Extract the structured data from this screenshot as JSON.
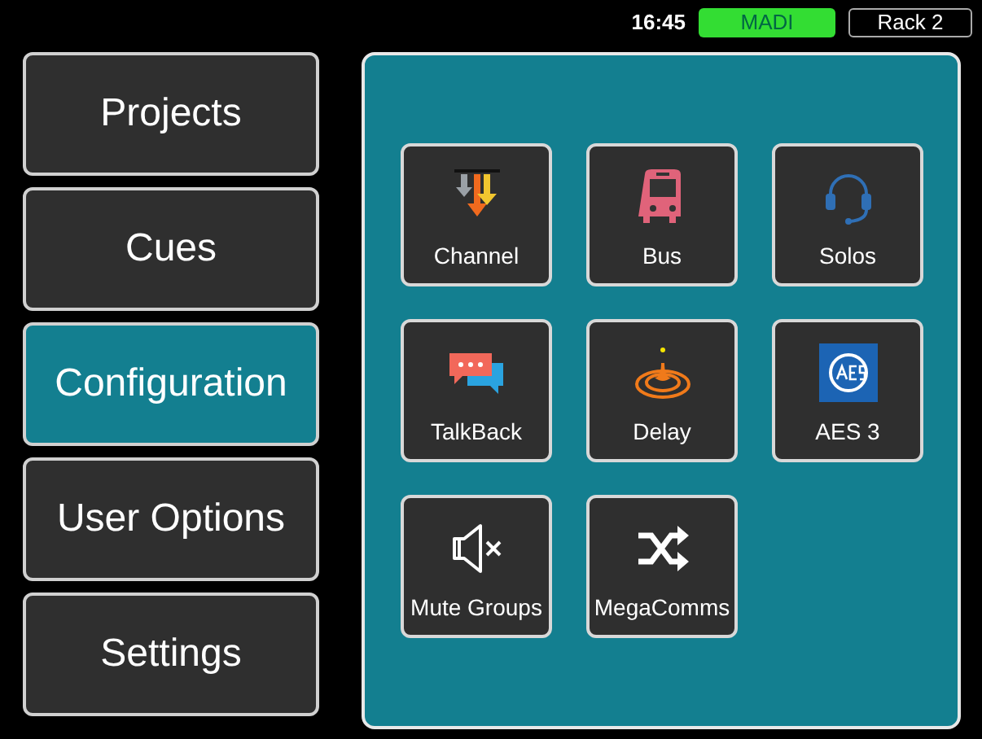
{
  "status_bar": {
    "time": "16:45",
    "interface": "MADI",
    "rack": "Rack 2"
  },
  "menu": [
    {
      "label": "Projects",
      "selected": false
    },
    {
      "label": "Cues",
      "selected": false
    },
    {
      "label": "Configuration",
      "selected": true
    },
    {
      "label": "User Options",
      "selected": false
    },
    {
      "label": "Settings",
      "selected": false
    }
  ],
  "tiles": [
    {
      "label": "Channel",
      "kind": "channel"
    },
    {
      "label": "Bus",
      "kind": "bus"
    },
    {
      "label": "Solos",
      "kind": "solos"
    },
    {
      "label": "TalkBack",
      "kind": "talkback"
    },
    {
      "label": "Delay",
      "kind": "delay"
    },
    {
      "label": "AES 3",
      "kind": "aes"
    },
    {
      "label": "Mute Groups",
      "kind": "mute"
    },
    {
      "label": "MegaComms",
      "kind": "megacomms"
    }
  ]
}
